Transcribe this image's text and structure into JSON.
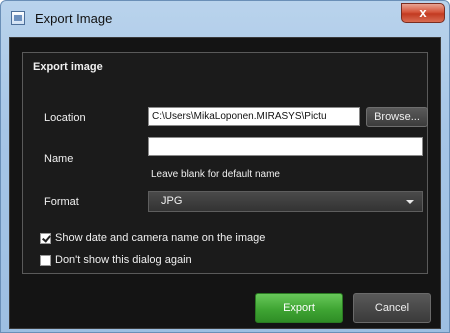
{
  "window": {
    "title": "Export Image",
    "close_label": "x"
  },
  "group": {
    "title": "Export image"
  },
  "location": {
    "label": "Location",
    "value": "C:\\Users\\MikaLoponen.MIRASYS\\Pictu",
    "browse_label": "Browse..."
  },
  "name": {
    "label": "Name",
    "value": "",
    "hint": "Leave blank for default name"
  },
  "format": {
    "label": "Format",
    "selected": "JPG"
  },
  "options": {
    "show_date_label": "Show date and camera name on the image",
    "show_date_checked": true,
    "dont_show_label": "Don't show this dialog again",
    "dont_show_checked": false
  },
  "actions": {
    "export_label": "Export",
    "cancel_label": "Cancel"
  },
  "colors": {
    "export_green": "#3fa533",
    "panel_dark": "#141414",
    "close_red": "#c23a21"
  }
}
